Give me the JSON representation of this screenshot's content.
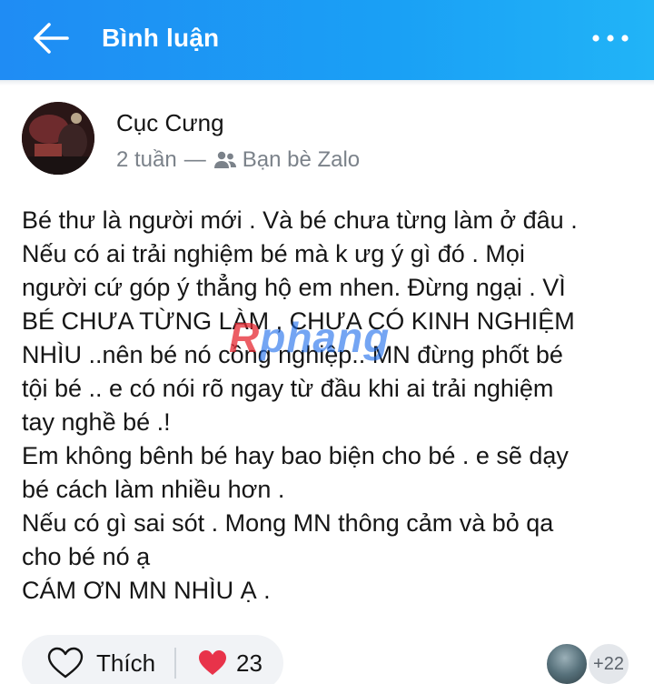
{
  "header": {
    "title": "Bình luận",
    "back_icon": "arrow-left-icon",
    "more_icon": "more-horizontal-icon"
  },
  "post": {
    "author": "Cục Cưng",
    "time": "2 tuần",
    "separator": "—",
    "audience": "Bạn bè Zalo",
    "audience_icon": "friends-icon",
    "text": "Bé thư là người mới . Và bé chưa từng làm ở đâu .\nNếu có ai trải nghiệm bé mà k ưg ý gì đó . Mọi\nngười cứ góp ý thẳng hộ em nhen. Đừng ngại . VÌ\nBÉ CHƯA TỪNG LÀM , CHƯA CÓ KINH NGHIỆM\nNHÌU ..nên bé nó cồng nghiệp.. MN đừng phốt bé\ntội bé .. e có nói rõ ngay từ đầu khi ai trải nghiệm\ntay nghề bé .!\nEm không bênh bé hay bao biện cho bé . e sẽ dạy\nbé cách làm nhiều hơn .\nNếu có gì sai sót . Mong MN thông cảm và bỏ qa\ncho bé nó ạ\nCÁM ƠN MN NHÌU Ạ ."
  },
  "watermark": {
    "first": "R",
    "rest": "phang"
  },
  "actions": {
    "like_label": "Thích",
    "like_icon": "heart-outline-icon",
    "reaction_icon": "heart-filled-icon",
    "reaction_count": "23",
    "viewers_more": "+22"
  },
  "colors": {
    "header_gradient_start": "#1f8cf4",
    "header_gradient_end": "#21b4f7",
    "heart": "#e8334a",
    "muted_text": "#7b828a"
  }
}
